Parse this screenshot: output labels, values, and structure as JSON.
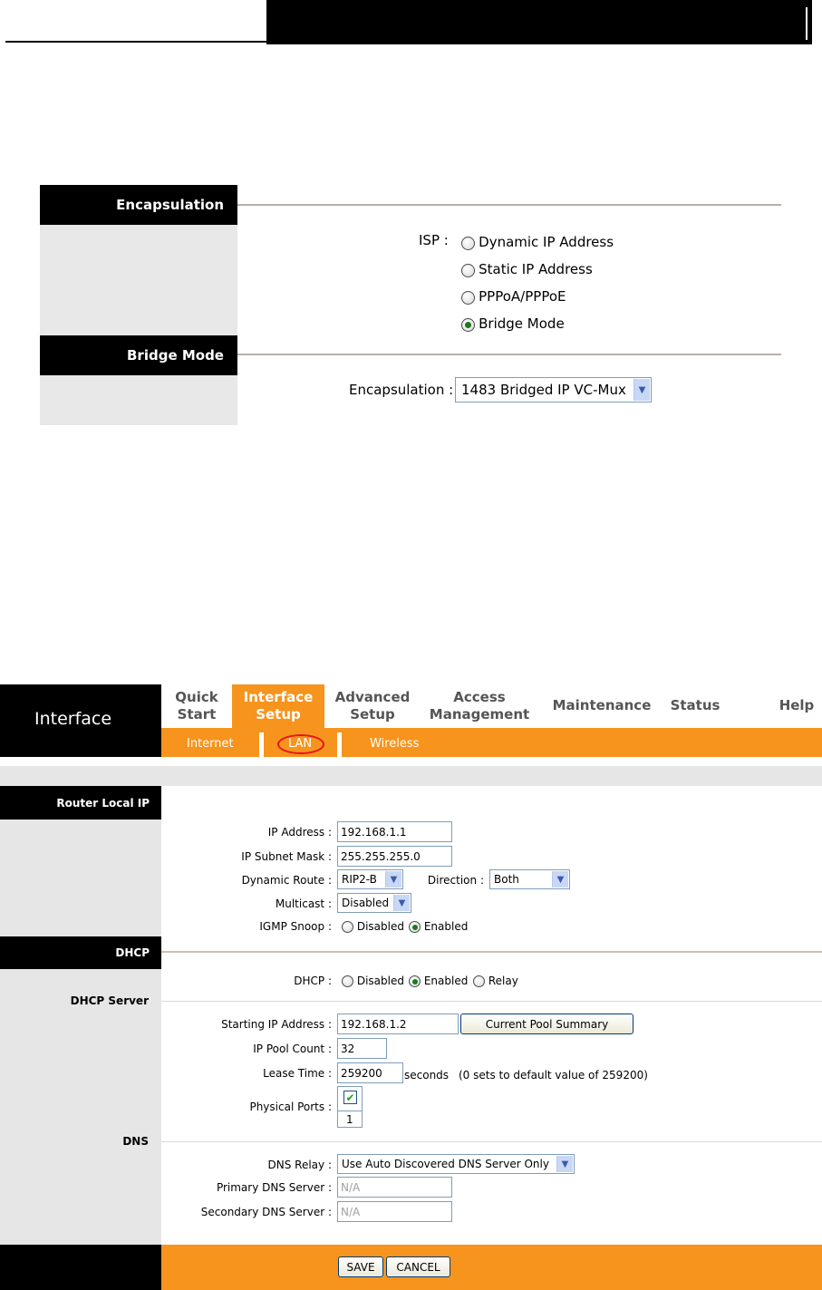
{
  "panel1": {
    "encapsulation_header": "Encapsulation",
    "isp_label": "ISP :",
    "isp_options": [
      {
        "label": "Dynamic IP Address",
        "selected": false
      },
      {
        "label": "Static IP Address",
        "selected": false
      },
      {
        "label": "PPPoA/PPPoE",
        "selected": false
      },
      {
        "label": "Bridge Mode",
        "selected": true
      }
    ],
    "bridge_header": "Bridge Mode",
    "encapsulation_label": "Encapsulation :",
    "encapsulation_value": "1483 Bridged IP VC-Mux"
  },
  "panel2": {
    "section_title": "Interface",
    "tabs": [
      {
        "line1": "Quick",
        "line2": "Start"
      },
      {
        "line1": "Interface",
        "line2": "Setup"
      },
      {
        "line1": "Advanced",
        "line2": "Setup"
      },
      {
        "line1": "Access",
        "line2": "Management"
      },
      {
        "line1": "Maintenance"
      },
      {
        "line1": "Status"
      },
      {
        "line1": "Help"
      }
    ],
    "subtabs": [
      "Internet",
      "LAN",
      "Wireless"
    ],
    "router_local_ip": {
      "header": "Router Local IP",
      "ip_address_label": "IP Address :",
      "ip_address": "192.168.1.1",
      "subnet_label": "IP Subnet Mask :",
      "subnet": "255.255.255.0",
      "dynamic_route_label": "Dynamic Route :",
      "dynamic_route": "RIP2-B",
      "direction_label": "Direction :",
      "direction": "Both",
      "multicast_label": "Multicast :",
      "multicast": "Disabled",
      "igmp_label": "IGMP Snoop :",
      "igmp_options": [
        {
          "label": "Disabled",
          "selected": false
        },
        {
          "label": "Enabled",
          "selected": true
        }
      ]
    },
    "dhcp": {
      "header": "DHCP",
      "dhcp_label": "DHCP :",
      "dhcp_options": [
        {
          "label": "Disabled",
          "selected": false
        },
        {
          "label": "Enabled",
          "selected": true
        },
        {
          "label": "Relay",
          "selected": false
        }
      ],
      "server_label": "DHCP Server",
      "start_ip_label": "Starting IP Address :",
      "start_ip": "192.168.1.2",
      "pool_summary_button": "Current Pool Summary",
      "pool_count_label": "IP Pool Count :",
      "pool_count": "32",
      "lease_label": "Lease Time :",
      "lease": "259200",
      "lease_unit": "seconds",
      "lease_note": "(0 sets to default value of 259200)",
      "ports_label": "Physical Ports :",
      "port_number": "1"
    },
    "dns": {
      "label": "DNS",
      "relay_label": "DNS Relay :",
      "relay": "Use Auto Discovered DNS Server Only",
      "primary_label": "Primary DNS Server :",
      "primary": "N/A",
      "secondary_label": "Secondary DNS Server :",
      "secondary": "N/A"
    },
    "buttons": {
      "save": "SAVE",
      "cancel": "CANCEL"
    }
  }
}
